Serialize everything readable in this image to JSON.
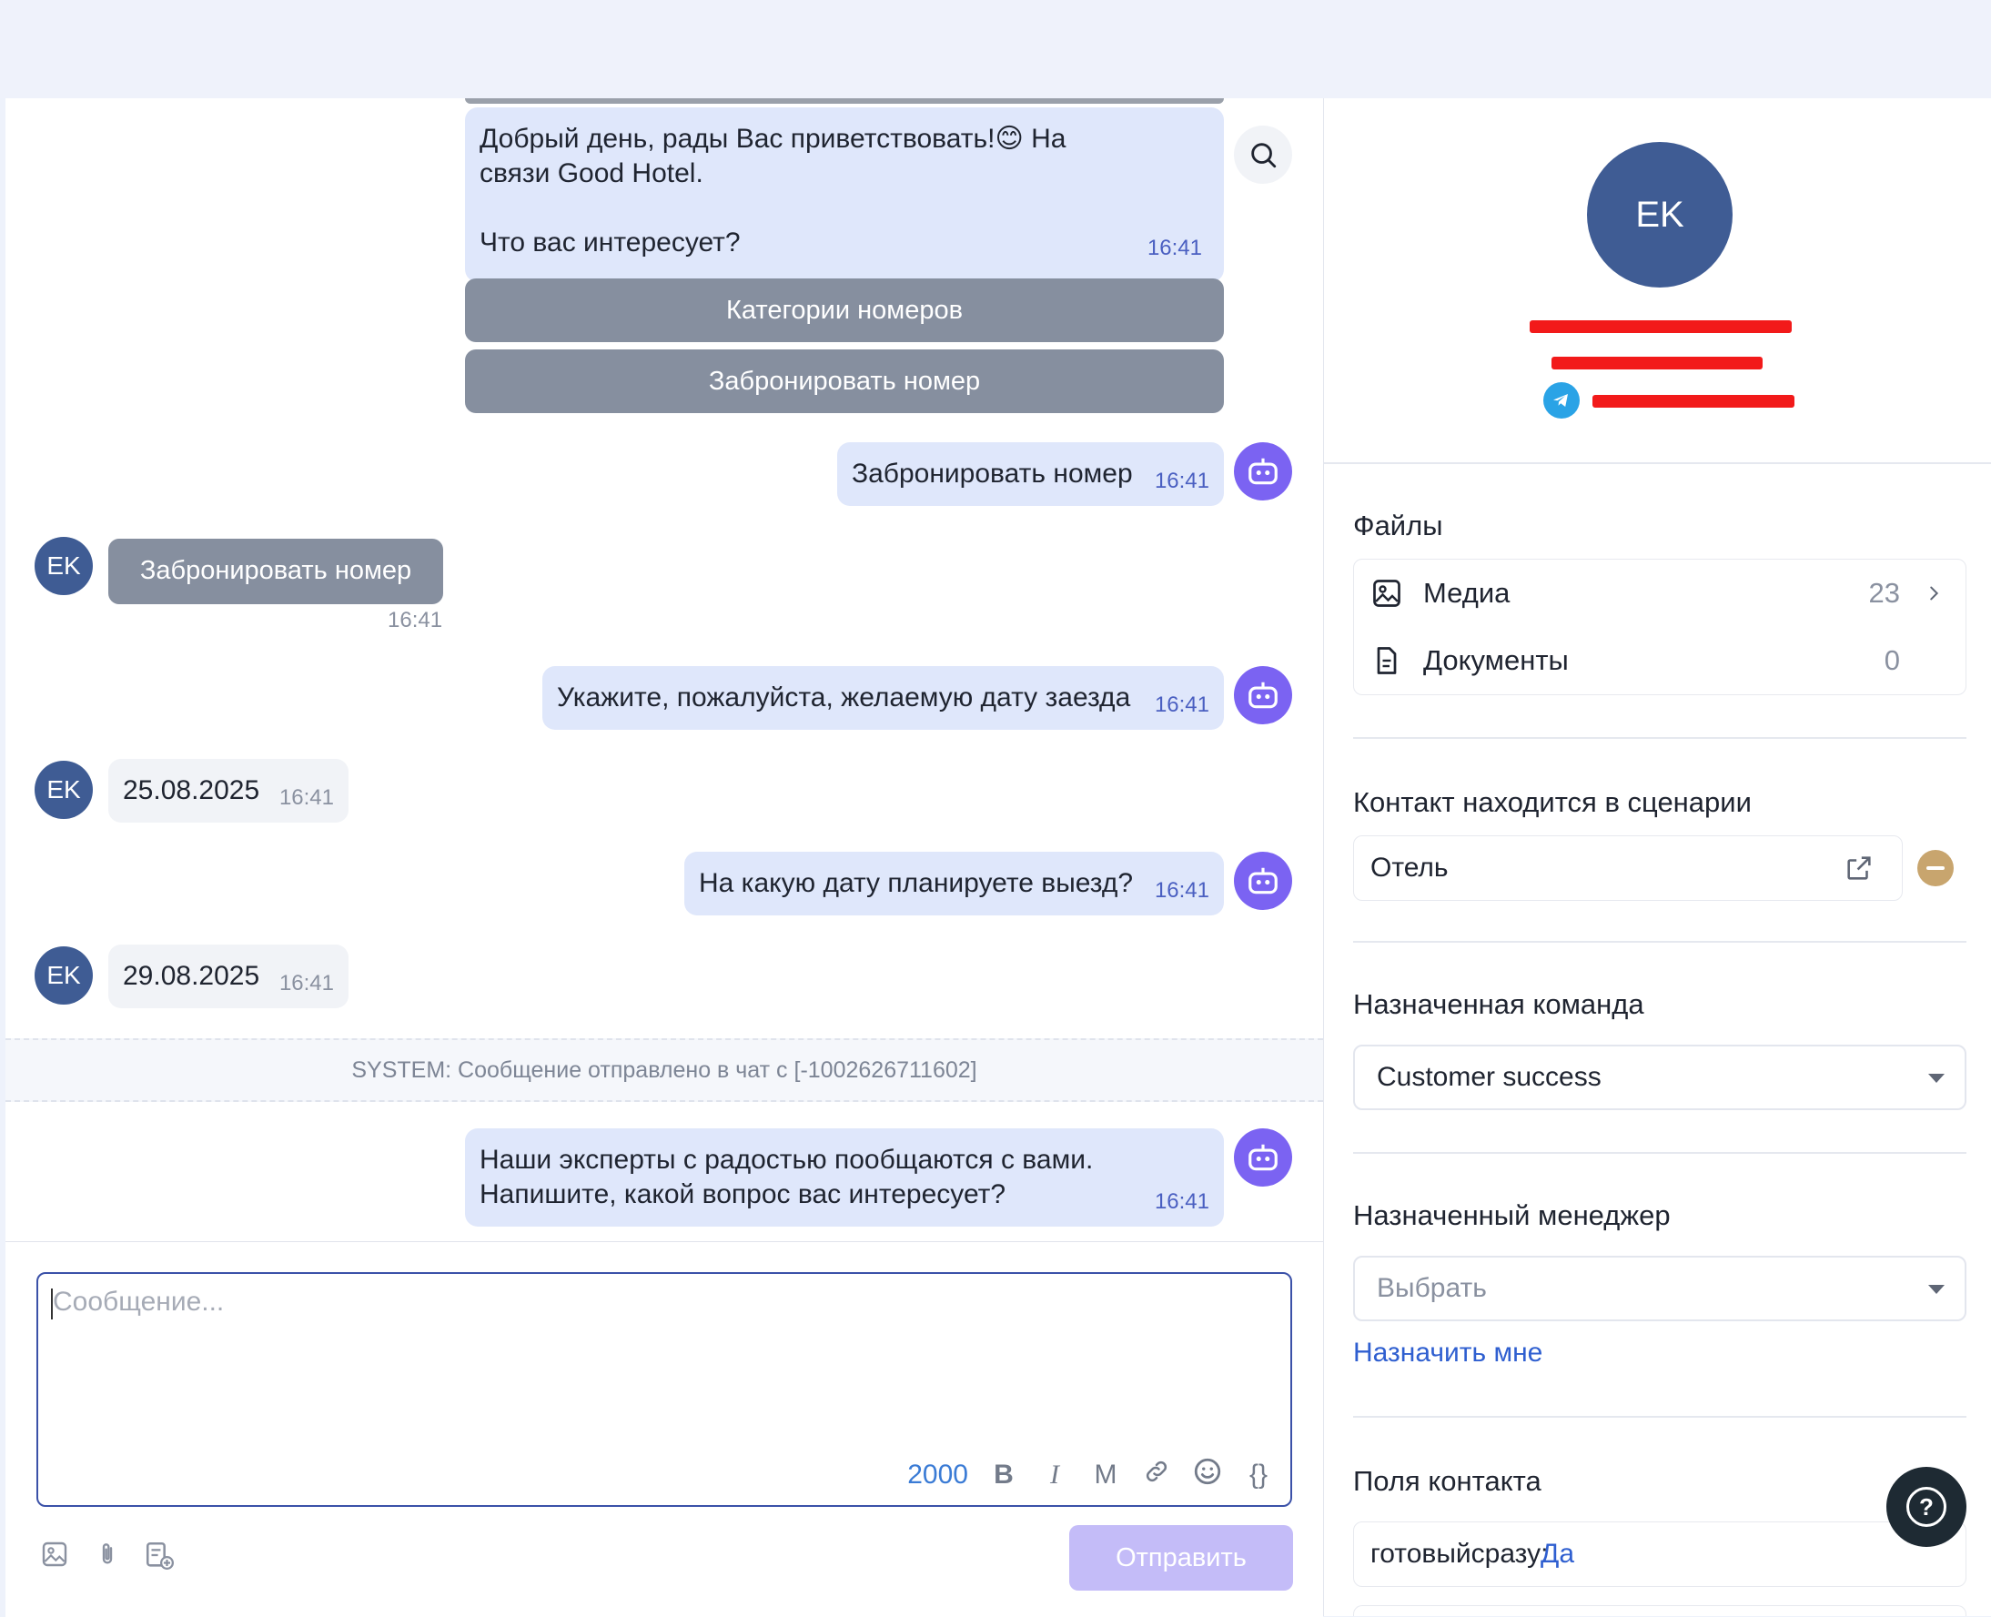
{
  "chat": {
    "messages": [
      {
        "text_lines": [
          "Добрый день, рады Вас приветствовать!😊 На",
          "связи Good Hotel.",
          "",
          "Что вас интересует?"
        ],
        "time": "16:41"
      },
      {
        "text": "Забронировать номер",
        "time": "16:41"
      },
      {
        "text": "Забронировать номер",
        "time": "16:41"
      },
      {
        "text": "Укажите, пожалуйста, желаемую дату заезда",
        "time": "16:41"
      },
      {
        "text": "25.08.2025",
        "time": "16:41"
      },
      {
        "text": "На какую дату планируете выезд?",
        "time": "16:41"
      },
      {
        "text": "29.08.2025",
        "time": "16:41"
      },
      {
        "text_lines": [
          "Наши эксперты с радостью пообщаются с вами.",
          "Напишите, какой вопрос вас интересует?"
        ],
        "time": "16:41"
      }
    ],
    "quick_buttons": [
      "Категории номеров",
      "Забронировать номер"
    ],
    "avatar_initials": "EK",
    "system_text": "SYSTEM: Сообщение отправлено в чат с [-1002626711602]",
    "composer": {
      "placeholder": "Сообщение...",
      "counter": "2000",
      "bold": "B",
      "italic": "I",
      "mono": "M",
      "variables": "{}",
      "send_label": "Отправить"
    }
  },
  "sidebar": {
    "avatar_initials": "EK",
    "files_title": "Файлы",
    "files": [
      {
        "label": "Медиа",
        "count": "23",
        "icon": "image-icon"
      },
      {
        "label": "Документы",
        "count": "0",
        "icon": "document-icon"
      }
    ],
    "scenario_title": "Контакт находится в сценарии",
    "scenario_name": "Отель",
    "team_title": "Назначенная команда",
    "team_value": "Customer success",
    "manager_title": "Назначенный менеджер",
    "manager_value": "Выбрать",
    "assign_me": "Назначить мне",
    "fields_title": "Поля контакта",
    "field_label": "готовыйсразу:",
    "field_value": "Да",
    "help": "?"
  },
  "colors": {
    "accent": "#7b63f2",
    "bot_bubble": "#dfe7fb",
    "user_avatar": "#3f5c94",
    "quick_button": "#868f9f"
  }
}
